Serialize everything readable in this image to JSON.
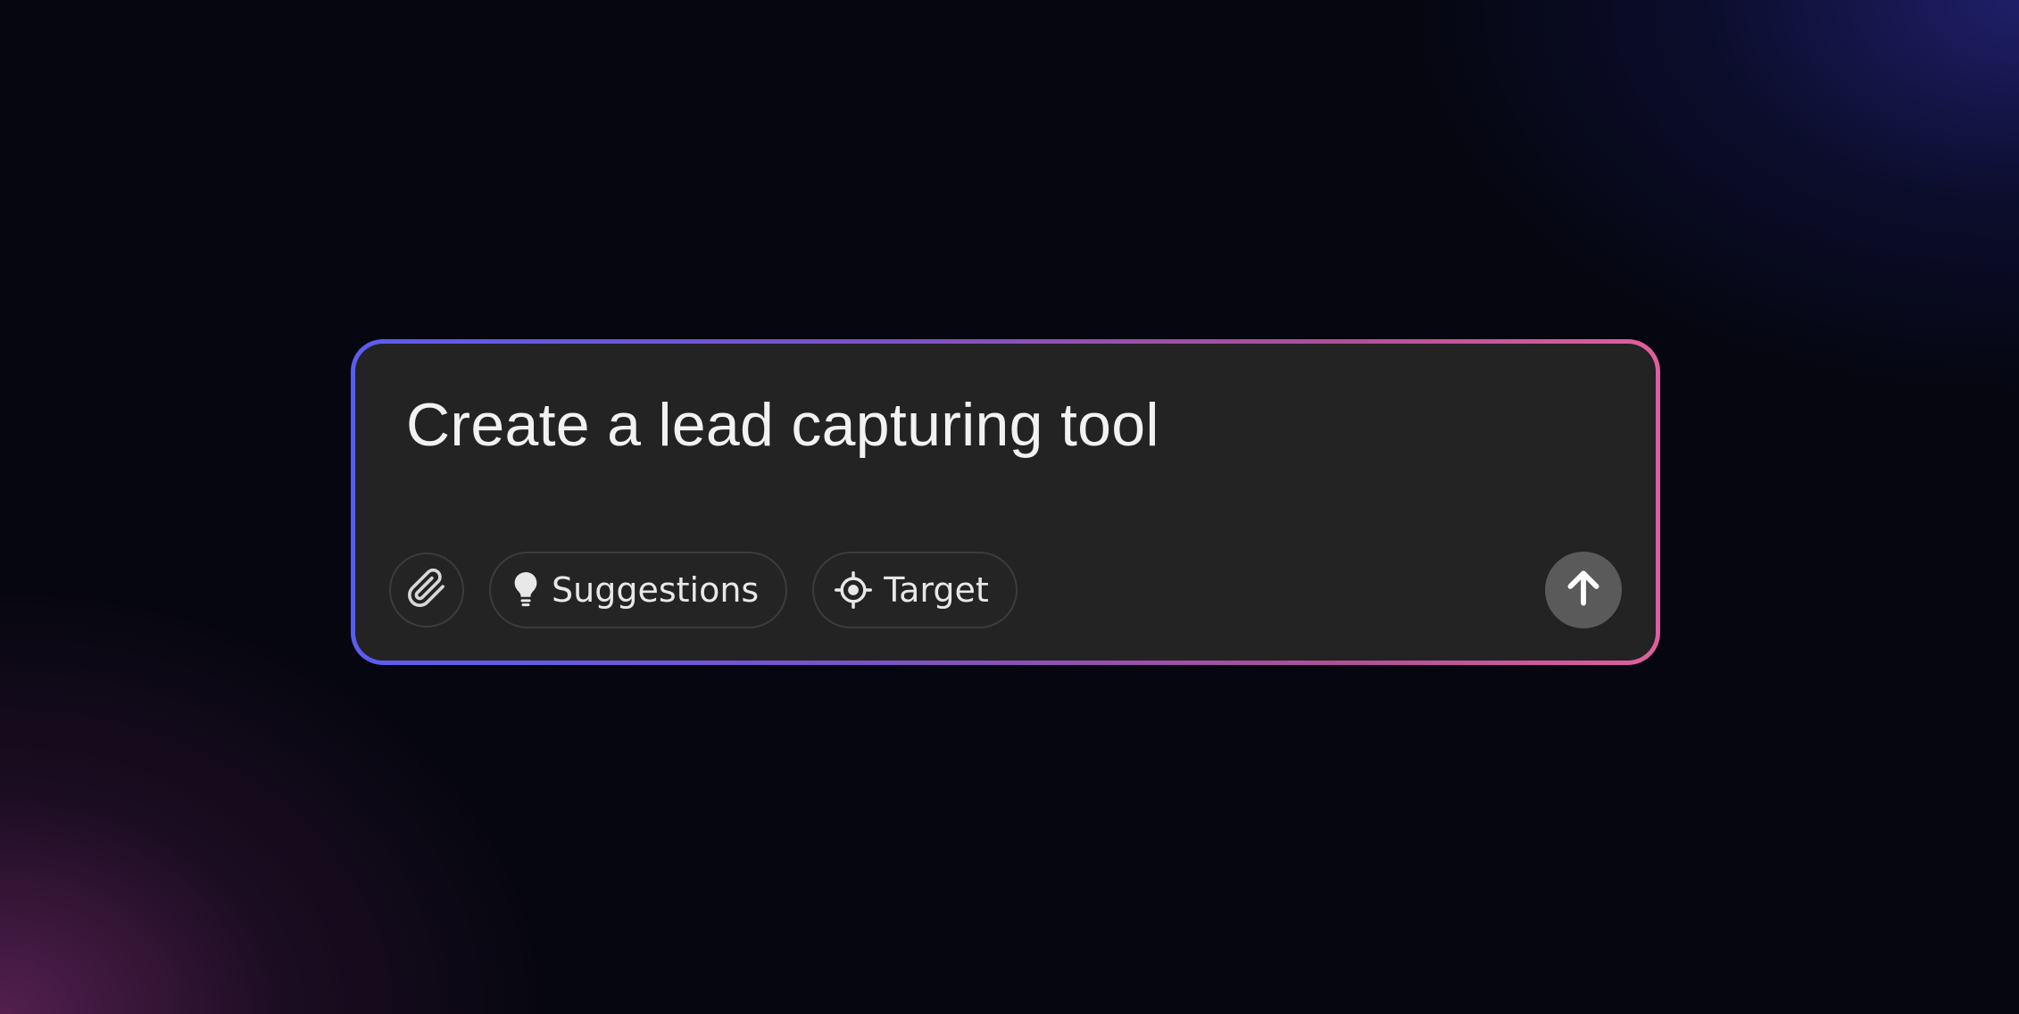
{
  "prompt": {
    "text": "Create a lead capturing tool"
  },
  "toolbar": {
    "attach_icon": "paperclip-icon",
    "suggestions_label": "Suggestions",
    "suggestions_icon": "lightbulb-icon",
    "target_label": "Target",
    "target_icon": "crosshair-icon"
  },
  "send": {
    "icon": "arrow-up-icon"
  },
  "colors": {
    "background": "#05060f",
    "box": "#232323",
    "border_gradient_start": "#5b5cf0",
    "border_gradient_end": "#df5f9e",
    "send_button": "#5a5a5a",
    "glow_bottom_left": "#6e2864",
    "glow_top_right": "#232378"
  }
}
